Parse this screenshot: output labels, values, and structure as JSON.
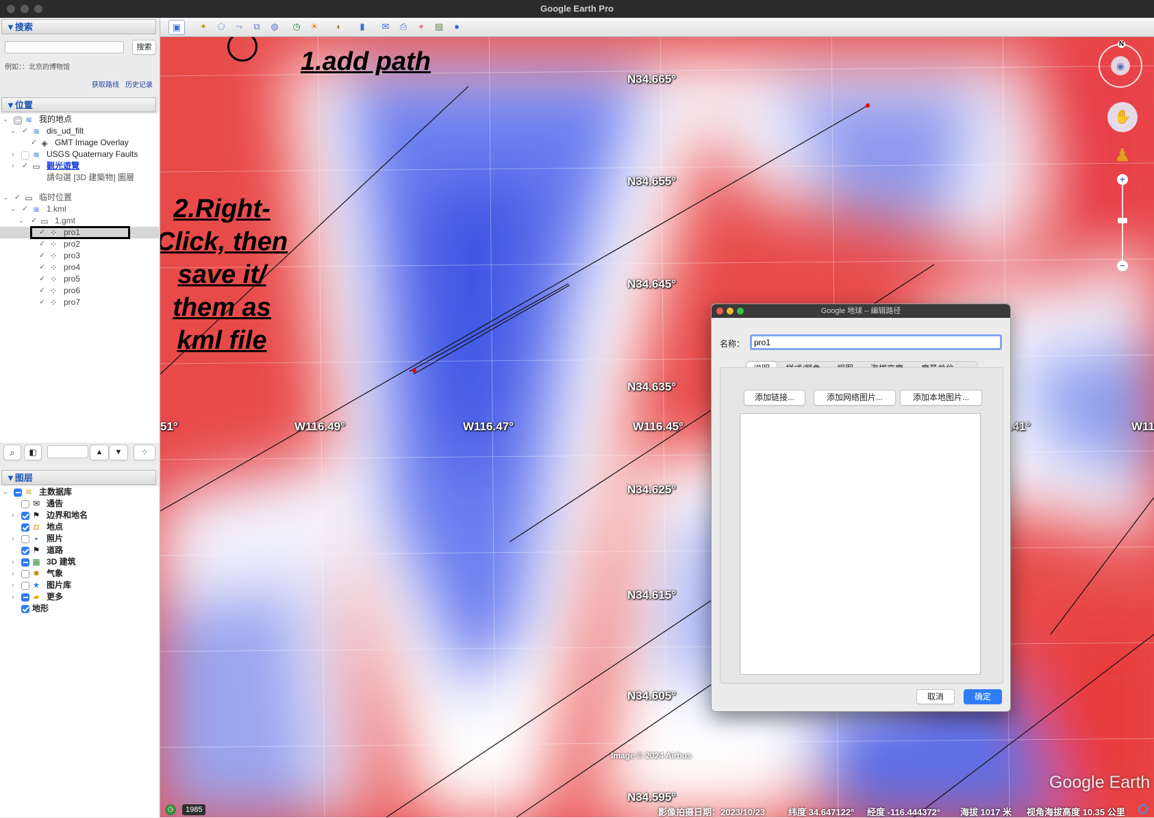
{
  "window": {
    "title": "Google Earth Pro"
  },
  "search": {
    "header": "▼搜索",
    "input_value": "",
    "button": "搜索",
    "example": "例如：：北京的博物馆",
    "get_route": "获取路线",
    "history": "历史记录"
  },
  "places": {
    "header": "▼位置",
    "items": [
      {
        "label": "我的地点"
      },
      {
        "label": "dis_ud_filt"
      },
      {
        "label": "GMT Image Overlay"
      },
      {
        "label": "USGS Quaternary Faults"
      },
      {
        "label": "觀光遊覽"
      },
      {
        "label": "請勾選 [3D 建築物] 圖層"
      },
      {
        "label": "临时位置"
      },
      {
        "label": "1.kml"
      },
      {
        "label": "1.gmt"
      },
      {
        "label": "pro1"
      },
      {
        "label": "pro2"
      },
      {
        "label": "pro3"
      },
      {
        "label": "pro4"
      },
      {
        "label": "pro5"
      },
      {
        "label": "pro6"
      },
      {
        "label": "pro7"
      }
    ]
  },
  "layers": {
    "header": "▼图层",
    "items": [
      {
        "label": "主数据库"
      },
      {
        "label": "通告"
      },
      {
        "label": "边界和地名"
      },
      {
        "label": "地点"
      },
      {
        "label": "照片"
      },
      {
        "label": "道路"
      },
      {
        "label": "3D 建筑"
      },
      {
        "label": "气象"
      },
      {
        "label": "图片库"
      },
      {
        "label": "更多"
      },
      {
        "label": "地形"
      }
    ]
  },
  "map": {
    "lat_labels": [
      "N34.665°",
      "N34.655°",
      "N34.645°",
      "N34.635°",
      "N34.625°",
      "N34.615°",
      "N34.605°",
      "N34.595°"
    ],
    "lon_labels": [
      "51°",
      "W116.49°",
      "W116.47°",
      "W116.45°",
      ".41°",
      "W11"
    ],
    "copyright": "Image © 2024 Airbus",
    "brand": "Google Earth",
    "compass_n": "N"
  },
  "annotations": {
    "step1": "1.add path",
    "step2_lines": [
      "2.Right-",
      "Click, then",
      "save it/",
      "them as",
      "kml file"
    ]
  },
  "dialog": {
    "title": "Google 地球 – 编辑路径",
    "name_label": "名称：",
    "name_value": "pro1",
    "tabs": [
      "说明",
      "样式/颜色",
      "视图",
      "海拔高度",
      "度量单位"
    ],
    "add_link": "添加链接...",
    "add_web_image": "添加网络图片...",
    "add_local_image": "添加本地图片...",
    "description": "",
    "cancel": "取消",
    "ok": "确定"
  },
  "status": {
    "year": "1985",
    "imagery_date": "影像拍摄日期：2023/10/23",
    "lat": "纬度  34.647122°",
    "lon": "经度 -116.444372°",
    "elev": "海拔  1017 米",
    "eye_alt": "视角海拔高度  10.35 公里"
  }
}
